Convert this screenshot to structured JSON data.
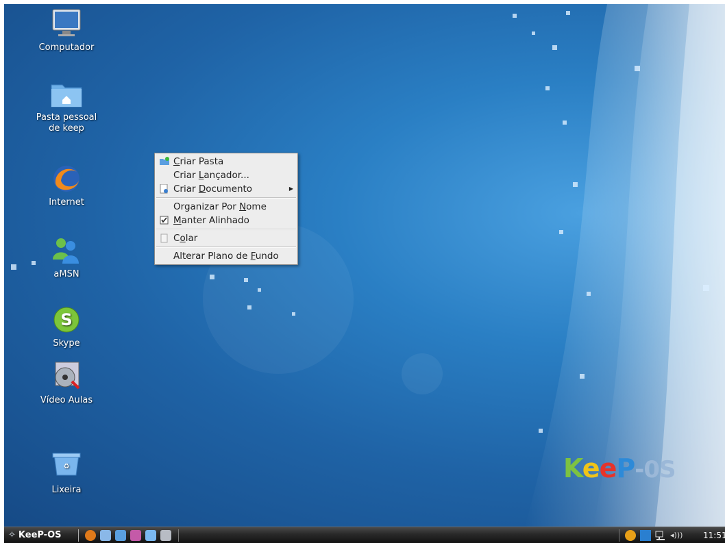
{
  "desktop": {
    "icons": [
      {
        "id": "computer",
        "label": "Computador"
      },
      {
        "id": "home",
        "label": "Pasta pessoal de keep"
      },
      {
        "id": "internet",
        "label": "Internet"
      },
      {
        "id": "amsn",
        "label": "aMSN"
      },
      {
        "id": "skype",
        "label": "Skype"
      },
      {
        "id": "video",
        "label": "Vídeo Aulas"
      },
      {
        "id": "trash",
        "label": "Lixeira"
      }
    ],
    "brand": {
      "k": "K",
      "e1": "e",
      "e2": "e",
      "p": "P",
      "os": "-0S"
    }
  },
  "context_menu": {
    "create_folder": {
      "pre": "",
      "u": "C",
      "post": "riar Pasta",
      "icon": "folder-new-icon"
    },
    "create_launcher": {
      "pre": "Criar ",
      "u": "L",
      "post": "ançador..."
    },
    "create_document": {
      "pre": "Criar ",
      "u": "D",
      "post": "ocumento",
      "icon": "document-new-icon"
    },
    "arrange_by_name": {
      "pre": "Organizar Por ",
      "u": "N",
      "post": "ome"
    },
    "keep_aligned": {
      "pre": "",
      "u": "M",
      "post": "anter Alinhado",
      "checked": true
    },
    "paste": {
      "pre": "C",
      "u": "o",
      "post": "lar",
      "icon": "paste-icon"
    },
    "change_background": {
      "pre": "Alterar Plano de ",
      "u": "F",
      "post": "undo"
    }
  },
  "taskbar": {
    "start_label": "KeeP-OS",
    "clock": "11:51"
  },
  "colors": {
    "menu_bg": "#ededed",
    "taskbar_bg": "#2a2a2a",
    "wallpaper": "#1f63a6"
  }
}
